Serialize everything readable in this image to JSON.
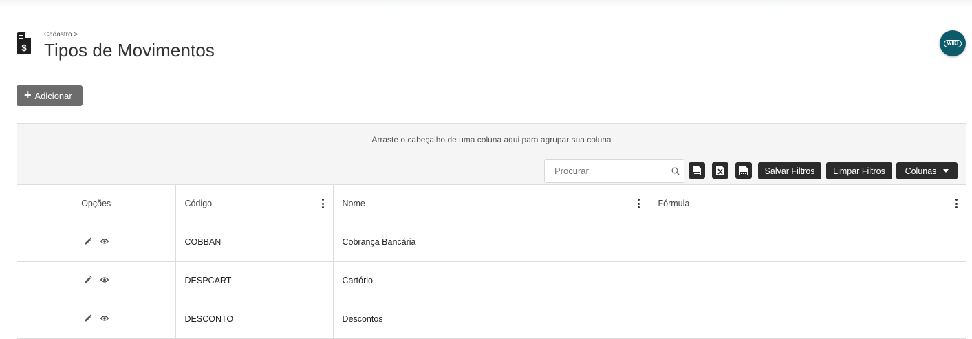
{
  "header": {
    "breadcrumb": "Cadastro >",
    "title": "Tipos de Movimentos",
    "icon": "dollar-document-icon",
    "wiki_label": "WIKI"
  },
  "actions": {
    "add_label": "Adicionar"
  },
  "grid": {
    "group_panel_text": "Arraste o cabeçalho de uma coluna aqui para agrupar sua coluna",
    "search_placeholder": "Procurar",
    "toolbar": {
      "pdf_icon": "pdf-export-icon",
      "excel_icon": "excel-export-icon",
      "csv_icon": "csv-export-icon",
      "save_filters_label": "Salvar Filtros",
      "clear_filters_label": "Limpar Filtros",
      "columns_label": "Colunas"
    },
    "columns": [
      "Opções",
      "Código",
      "Nome",
      "Fórmula"
    ],
    "rows": [
      {
        "codigo": "COBBAN",
        "nome": "Cobrança Bancária",
        "formula": ""
      },
      {
        "codigo": "DESPCART",
        "nome": "Cartório",
        "formula": ""
      },
      {
        "codigo": "DESCONTO",
        "nome": "Descontos",
        "formula": ""
      }
    ]
  },
  "colors": {
    "primary_dark": "#2b2b2b",
    "add_button": "#6c6c6c",
    "wiki_badge": "#0d5a6b",
    "panel_bg": "#f5f5f5"
  }
}
